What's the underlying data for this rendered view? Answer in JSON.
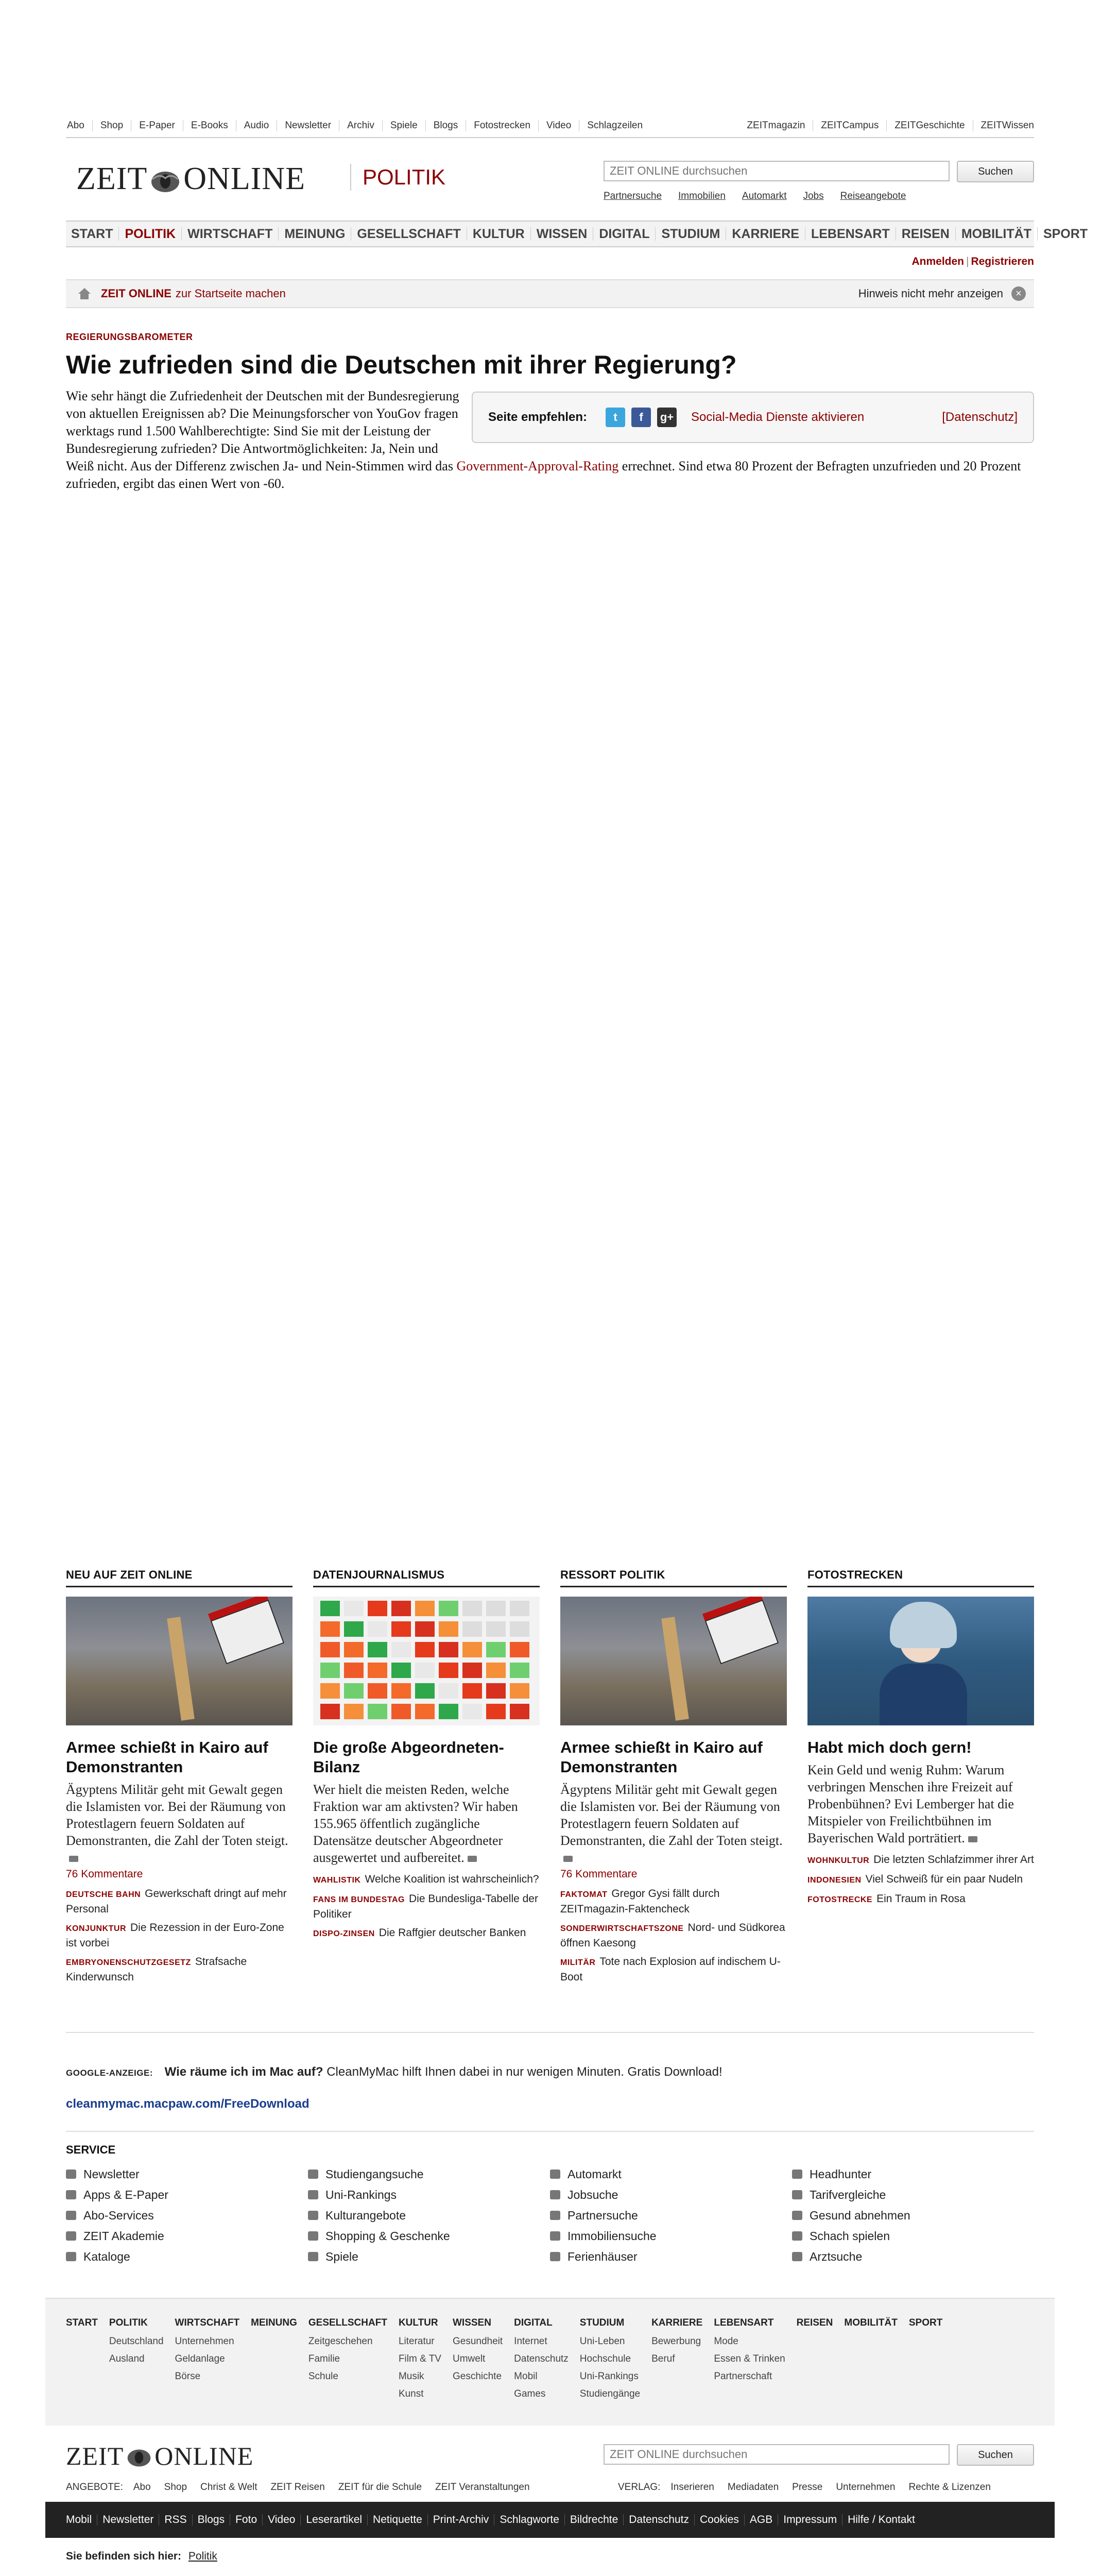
{
  "topnav": {
    "left": [
      "Abo",
      "Shop",
      "E-Paper",
      "E-Books",
      "Audio",
      "Newsletter",
      "Archiv",
      "Spiele",
      "Blogs",
      "Fotostrecken",
      "Video",
      "Schlagzeilen"
    ],
    "right": [
      "ZEITmagazin",
      "ZEITCampus",
      "ZEITGeschichte",
      "ZEITWissen"
    ]
  },
  "header": {
    "logo_left": "ZEIT",
    "logo_right": "ONLINE",
    "section": "POLITIK",
    "search_placeholder": "ZEIT ONLINE durchsuchen",
    "search_button": "Suchen",
    "quicklinks": [
      "Partnersuche",
      "Immobilien",
      "Automarkt",
      "Jobs",
      "Reiseangebote"
    ]
  },
  "mainnav": [
    "START",
    "POLITIK",
    "WIRTSCHAFT",
    "MEINUNG",
    "GESELLSCHAFT",
    "KULTUR",
    "WISSEN",
    "DIGITAL",
    "STUDIUM",
    "KARRIERE",
    "LEBENSART",
    "REISEN",
    "MOBILITÄT",
    "SPORT"
  ],
  "account": {
    "login": "Anmelden",
    "register": "Registrieren"
  },
  "hint": {
    "brand": "ZEIT ONLINE",
    "text": "zur Startseite machen",
    "dismiss": "Hinweis nicht mehr anzeigen"
  },
  "article": {
    "kicker": "REGIERUNGSBAROMETER",
    "headline": "Wie zufrieden sind die Deutschen mit ihrer Regierung?",
    "body_start": "Wie sehr hängt die Zufriedenheit der Deutschen mit der Bundesregierung von aktuellen Ereignissen ab? Die Meinungsforscher von YouGov fragen werktags rund 1.500 Wahlberechtigte: Sind Sie mit der Leistung der Bundesregierung zufrieden? Die Antwortmöglichkeiten: Ja, Nein und Weiß nicht. Aus der Differenz zwischen Ja- und Nein-Stimmen wird das ",
    "body_link": "Government-Approval-Rating",
    "body_end": " errechnet. Sind etwa 80 Prozent der Befragten unzufrieden und 20 Prozent zufrieden, ergibt das einen Wert von -60."
  },
  "share": {
    "label": "Seite empfehlen:",
    "activate": "Social-Media Dienste aktivieren",
    "privacy": "[Datenschutz]"
  },
  "teasers": [
    {
      "heading": "NEU AUF ZEIT ONLINE",
      "title": "Armee schießt in Kairo auf Demonstranten",
      "text": "Ägyptens Militär geht mit Gewalt gegen die Islamisten vor. Bei der Räumung von Protestlagern feuern Soldaten auf Demonstranten, die Zahl der Toten steigt.",
      "comments": "76 Kommentare",
      "links": [
        {
          "kicker": "DEUTSCHE BAHN",
          "text": "Gewerkschaft dringt auf mehr Personal"
        },
        {
          "kicker": "KONJUNKTUR",
          "text": "Die Rezession in der Euro-Zone ist vorbei"
        },
        {
          "kicker": "EMBRYONENSCHUTZGESETZ",
          "text": "Strafsache Kinderwunsch"
        }
      ]
    },
    {
      "heading": "DATENJOURNALISMUS",
      "title": "Die große Abgeordneten-Bilanz",
      "text": "Wer hielt die meisten Reden, welche Fraktion war am aktivsten? Wir haben 155.965 öffentlich zugängliche Datensätze deutscher Abgeordneter ausgewertet und aufbereitet.",
      "comments": "",
      "links": [
        {
          "kicker": "WAHLISTIK",
          "text": "Welche Koalition ist wahrscheinlich?"
        },
        {
          "kicker": "FANS IM BUNDESTAG",
          "text": "Die Bundesliga-Tabelle der Politiker"
        },
        {
          "kicker": "DISPO-ZINSEN",
          "text": "Die Raffgier deutscher Banken"
        }
      ]
    },
    {
      "heading": "RESSORT POLITIK",
      "title": "Armee schießt in Kairo auf Demonstranten",
      "text": "Ägyptens Militär geht mit Gewalt gegen die Islamisten vor. Bei der Räumung von Protestlagern feuern Soldaten auf Demonstranten, die Zahl der Toten steigt.",
      "comments": "76 Kommentare",
      "links": [
        {
          "kicker": "FAKTOMAT",
          "text": "Gregor Gysi fällt durch ZEITmagazin-Faktencheck"
        },
        {
          "kicker": "SONDERWIRTSCHAFTSZONE",
          "text": "Nord- und Südkorea öffnen Kaesong"
        },
        {
          "kicker": "MILITÄR",
          "text": "Tote nach Explosion auf indischem U-Boot"
        }
      ]
    },
    {
      "heading": "FOTOSTRECKEN",
      "title": "Habt mich doch gern!",
      "text": "Kein Geld und wenig Ruhm: Warum verbringen Menschen ihre Freizeit auf Probenbühnen? Evi Lemberger hat die Mitspieler von Freilichtbühnen im Bayerischen Wald porträtiert.",
      "comments": "",
      "links": [
        {
          "kicker": "WOHNKULTUR",
          "text": "Die letzten Schlafzimmer ihrer Art"
        },
        {
          "kicker": "INDONESIEN",
          "text": "Viel Schweiß für ein paar Nudeln"
        },
        {
          "kicker": "FOTOSTRECKE",
          "text": "Ein Traum in Rosa"
        }
      ]
    }
  ],
  "ad": {
    "label": "GOOGLE-ANZEIGE:",
    "title": "Wie räume ich im Mac auf?",
    "text": "CleanMyMac hilft Ihnen dabei in nur wenigen Minuten. Gratis Download!",
    "url": "cleanmymac.macpaw.com/FreeDownload"
  },
  "service": {
    "heading": "SERVICE",
    "cols": [
      [
        "Newsletter",
        "Apps & E-Paper",
        "Abo-Services",
        "ZEIT Akademie",
        "Kataloge"
      ],
      [
        "Studiengangsuche",
        "Uni-Rankings",
        "Kulturangebote",
        "Shopping & Geschenke",
        "Spiele"
      ],
      [
        "Automarkt",
        "Jobsuche",
        "Partnersuche",
        "Immobiliensuche",
        "Ferienhäuser"
      ],
      [
        "Headhunter",
        "Tarifvergleiche",
        "Gesund abnehmen",
        "Schach spielen",
        "Arztsuche"
      ]
    ]
  },
  "sitemap": [
    {
      "h": "START",
      "s": []
    },
    {
      "h": "POLITIK",
      "s": [
        "Deutschland",
        "Ausland"
      ]
    },
    {
      "h": "WIRTSCHAFT",
      "s": [
        "Unternehmen",
        "Geldanlage",
        "Börse"
      ]
    },
    {
      "h": "MEINUNG",
      "s": []
    },
    {
      "h": "GESELLSCHAFT",
      "s": [
        "Zeitgeschehen",
        "Familie",
        "Schule"
      ]
    },
    {
      "h": "KULTUR",
      "s": [
        "Literatur",
        "Film & TV",
        "Musik",
        "Kunst"
      ]
    },
    {
      "h": "WISSEN",
      "s": [
        "Gesundheit",
        "Umwelt",
        "Geschichte"
      ]
    },
    {
      "h": "DIGITAL",
      "s": [
        "Internet",
        "Datenschutz",
        "Mobil",
        "Games"
      ]
    },
    {
      "h": "STUDIUM",
      "s": [
        "Uni-Leben",
        "Hochschule",
        "Uni-Rankings",
        "Studiengänge"
      ]
    },
    {
      "h": "KARRIERE",
      "s": [
        "Bewerbung",
        "Beruf"
      ]
    },
    {
      "h": "LEBENSART",
      "s": [
        "Mode",
        "Essen & Trinken",
        "Partnerschaft"
      ]
    },
    {
      "h": "REISEN",
      "s": []
    },
    {
      "h": "MOBILITÄT",
      "s": []
    },
    {
      "h": "SPORT",
      "s": []
    }
  ],
  "offers": {
    "label": "ANGEBOTE:",
    "items": [
      "Abo",
      "Shop",
      "Christ & Welt",
      "ZEIT Reisen",
      "ZEIT für die Schule",
      "ZEIT Veranstaltungen"
    ],
    "verlag_label": "VERLAG:",
    "verlag_items": [
      "Inserieren",
      "Mediadaten",
      "Presse",
      "Unternehmen",
      "Rechte & Lizenzen"
    ]
  },
  "darkbar": [
    "Mobil",
    "Newsletter",
    "RSS",
    "Blogs",
    "Foto",
    "Video",
    "Leserartikel",
    "Netiquette",
    "Print-Archiv",
    "Schlagworte",
    "Bildrechte",
    "Datenschutz",
    "Cookies",
    "AGB",
    "Impressum",
    "Hilfe / Kontakt"
  ],
  "breadcrumb": {
    "label": "Sie befinden sich hier:",
    "current": "Politik"
  }
}
